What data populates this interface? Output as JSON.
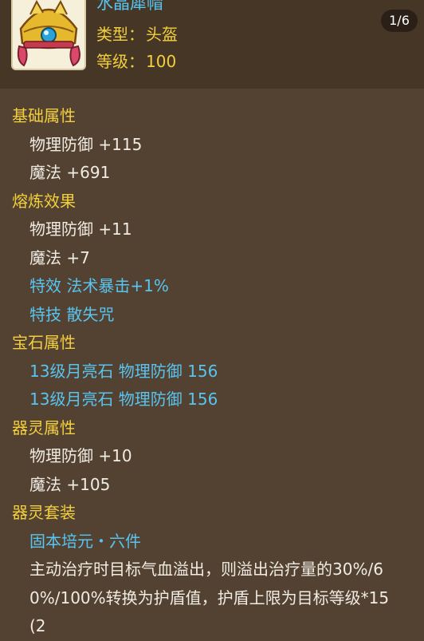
{
  "header": {
    "item_name": "水晶犀帽",
    "type_label": "类型：",
    "type_value": "头盔",
    "level_label": "等级：",
    "level_value": "100",
    "page_indicator": "1/6",
    "icon": "crystal-helmet-icon"
  },
  "sections": {
    "base": {
      "title": "基础属性",
      "lines": [
        "物理防御 +115",
        "魔法 +691"
      ]
    },
    "refine": {
      "title": "熔炼效果",
      "lines": [
        "物理防御 +11",
        "魔法 +7"
      ],
      "special_effect": "特效 法术暴击+1%",
      "special_skill": "特技 散失咒"
    },
    "gem": {
      "title": "宝石属性",
      "lines": [
        "13级月亮石 物理防御 156",
        "13级月亮石 物理防御 156"
      ]
    },
    "spirit": {
      "title": "器灵属性",
      "lines": [
        "物理防御 +10",
        "魔法 +105"
      ]
    },
    "spirit_set": {
      "title": "器灵套装",
      "set_name": "固本培元・六件",
      "description": "主动治疗时目标气血溢出，则溢出治疗量的30%/60%/100%转换为护盾值，护盾上限为目标等级*15(2"
    }
  },
  "colors": {
    "background": "#534232",
    "header_background": "#463626",
    "section_title": "#f2cf3d",
    "highlight_blue": "#58c4f0",
    "body_text": "#f0ece4"
  }
}
